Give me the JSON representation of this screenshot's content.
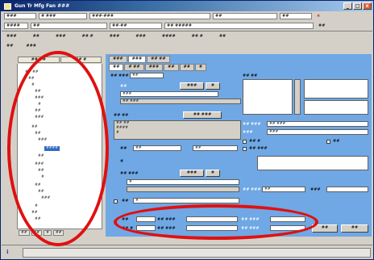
{
  "window": {
    "title": "Gun Tr Mfg Fan ###",
    "buttons": [
      "_",
      "□",
      "x"
    ]
  },
  "toolbar_row1": {
    "fields": [
      "###",
      "# ###",
      "###-###",
      "##",
      "##"
    ],
    "close_label": "×"
  },
  "toolbar_row2": {
    "fields": [
      "####",
      "##",
      "##-##",
      "## #####"
    ],
    "trailing": "##"
  },
  "menu": {
    "items": [
      "###",
      "##",
      "###",
      "## #",
      "###",
      "###",
      "####",
      "## #",
      "##"
    ]
  },
  "sub_row": {
    "items": [
      "##",
      "###"
    ]
  },
  "left_panel": {
    "tabs": [
      "## ##",
      "## #"
    ],
    "tree": [
      "## ##",
      "##",
      "#",
      "##",
      "###",
      "#",
      "##",
      "###",
      "##",
      "##",
      "###",
      "##",
      "###",
      "##",
      "#",
      "##",
      "##",
      "###",
      "#",
      "##",
      "##",
      "###",
      "##",
      "##"
    ],
    "selected_item": "####",
    "footer_buttons": [
      "##",
      "##",
      "#",
      "##"
    ]
  },
  "main": {
    "tabs_top": [
      "###",
      "###",
      "## ##"
    ],
    "tabs_second": [
      "##",
      "# ##",
      "###",
      "##",
      "##",
      "#"
    ],
    "name_label": "## ###",
    "name_value": "##",
    "list_label": "## ##",
    "section1_title": "##",
    "section1_value1": "###",
    "section1_value2": "## ###",
    "section1_btn1": "###",
    "section1_btn2": "#",
    "section2_title": "## ##",
    "section2_btn": "## ###",
    "section2_lines": [
      "## ##",
      "####",
      "#"
    ],
    "right_label1": "## ###",
    "right_field1": "## ###",
    "right_label2": "###",
    "right_field2": "###",
    "checkbox1": "## #",
    "checkbox2": "##",
    "checkbox3": "## ###",
    "mid_label1": "##",
    "mid_field1": "##",
    "mid_label2": "#",
    "mid_label3": "## ###",
    "mid_btn1": "###",
    "mid_btn2": "#",
    "mid_field2": "#",
    "mid_field3": "##",
    "lower_label": "##",
    "lower_field": "#",
    "lower_right_label": "## ###",
    "lower_right_value": "##",
    "lower_right_label2": "###",
    "bottom_rows": [
      {
        "label": "##",
        "a_label": "## ###",
        "a_field": "",
        "b_label": "## ###",
        "b_field": ""
      },
      {
        "label": "## #",
        "a_label": "## ###",
        "a_field": "",
        "b_label": "## ###",
        "b_field": ""
      }
    ],
    "bottom_buttons": [
      "##",
      "##"
    ]
  },
  "status": {
    "icon": "info-icon",
    "text": ""
  },
  "annotations": {
    "color": "#e01010"
  }
}
